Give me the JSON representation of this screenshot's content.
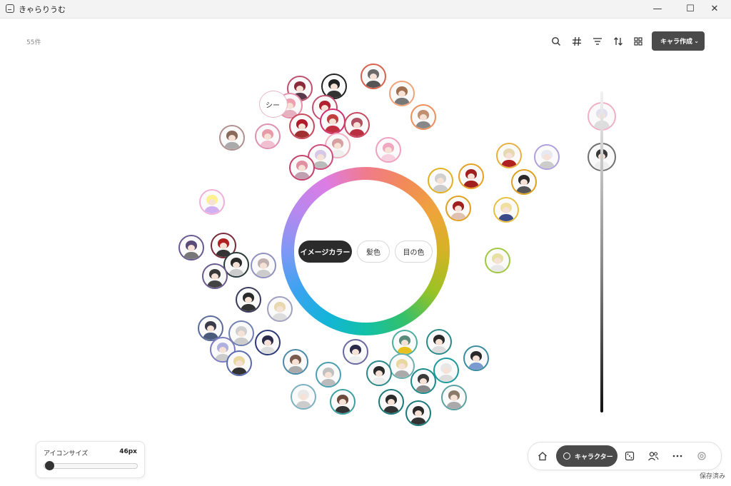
{
  "window": {
    "title": "きゃらりうむ",
    "minimize": "—",
    "maximize": "☐",
    "close": "✕"
  },
  "header": {
    "count": "55件",
    "create_button": "キャラ作成",
    "tools": [
      "search-icon",
      "hash-icon",
      "filter-icon",
      "sort-icon",
      "grid-icon"
    ]
  },
  "bubble_label": "シー",
  "color_modes": {
    "active": "イメージカラー",
    "hair": "髪色",
    "eyes": "目の色"
  },
  "icon_size": {
    "label": "アイコンサイズ",
    "value": "46px",
    "level": 0.1
  },
  "nav": {
    "characters": "キャラクター"
  },
  "status": {
    "saved": "保存済み"
  },
  "colors": {
    "accent_dark": "#2b2b2b",
    "button_bg": "#4a4a4a"
  }
}
